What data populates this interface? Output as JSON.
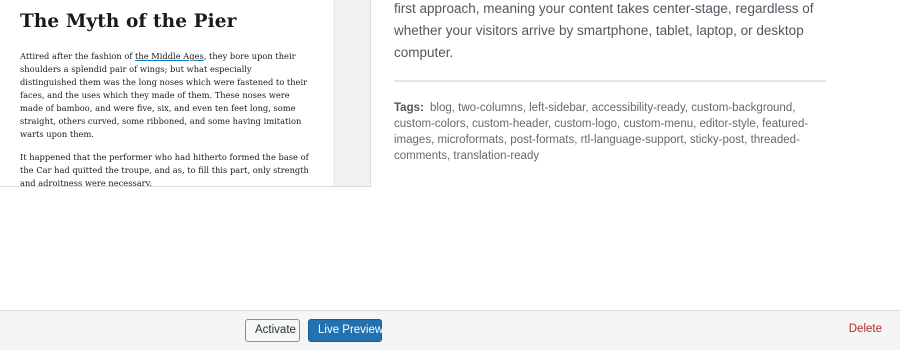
{
  "screenshot": {
    "post_title": "The Myth of the Pier",
    "paragraph1_before_link": "Attired after the fashion of ",
    "paragraph1_link": "the Middle Ages",
    "paragraph1_after_link": ", they bore upon their shoulders a splendid pair of wings; but what especially distinguished them was the long noses which were fastened to their faces, and the uses which they made of them. These noses were made of bamboo, and were five, six, and even ten feet long, some straight, others curved, some ribboned, and some having imitation warts upon them.",
    "paragraph2": "It happened that the performer who had hitherto formed the base of the Car had quitted the troupe, and as, to fill this part, only strength and adroitness were necessary."
  },
  "details": {
    "description": "first approach, meaning your content takes center-stage, regardless of whether your visitors arrive by smartphone, tablet, laptop, or desktop computer.",
    "tags_label": "Tags:",
    "tags_list": "blog, two-columns, left-sidebar, accessibility-ready, custom-background, custom-colors, custom-header, custom-logo, custom-menu, editor-style, featured-images, microformats, post-formats, rtl-language-support, sticky-post, threaded-comments, translation-ready"
  },
  "actions": {
    "activate_label": "Activate",
    "live_preview_label": "Live Preview",
    "delete_label": "Delete"
  },
  "colors": {
    "primary_button": "#2271b1",
    "delete_link": "#b32d2e"
  }
}
